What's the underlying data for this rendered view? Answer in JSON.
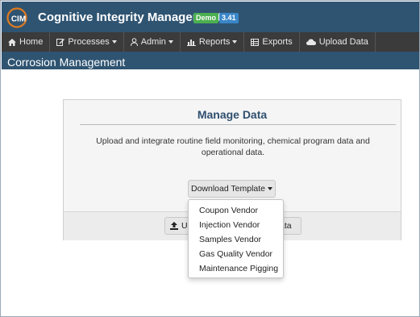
{
  "header": {
    "logo_text": "CIM",
    "title": "Cognitive Integrity Management",
    "badge_demo": "Demo",
    "badge_version": "3.41"
  },
  "nav": {
    "items": [
      {
        "label": "Home",
        "icon": "home-icon",
        "has_caret": false
      },
      {
        "label": "Processes",
        "icon": "edit-icon",
        "has_caret": true
      },
      {
        "label": "Admin",
        "icon": "user-icon",
        "has_caret": true
      },
      {
        "label": "Reports",
        "icon": "bar-chart-icon",
        "has_caret": true
      },
      {
        "label": "Exports",
        "icon": "table-icon",
        "has_caret": false
      },
      {
        "label": "Upload Data",
        "icon": "cloud-icon",
        "has_caret": false
      }
    ]
  },
  "page": {
    "title": "Corrosion Management"
  },
  "panel": {
    "heading": "Manage Data",
    "description": "Upload and integrate routine field monitoring, chemical program data and operational data.",
    "download_button_label": "Download Template",
    "upload_button_left": "Up",
    "upload_button_right": "ata"
  },
  "dropdown": {
    "items": [
      "Coupon Vendor",
      "Injection Vendor",
      "Samples Vendor",
      "Gas Quality Vendor",
      "Maintenance Pigging"
    ]
  },
  "colors": {
    "header_bg": "#2f5472",
    "nav_bg": "#3b3b3b",
    "demo_badge": "#4caf50",
    "version_badge": "#3a86c8",
    "logo_accent": "#e07a1f"
  }
}
